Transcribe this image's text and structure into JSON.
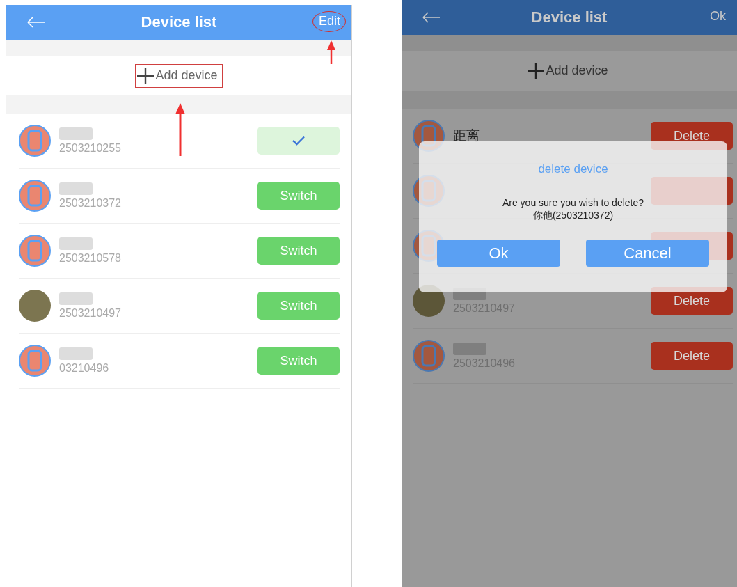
{
  "screens": [
    {
      "dimmed": false,
      "annotated": true,
      "header": {
        "title": "Device list",
        "action": "Edit"
      },
      "add_label": "Add device",
      "rows": [
        {
          "name_blurred": true,
          "avatar": {
            "kind": "watch"
          },
          "id": "2503210255",
          "selected": true,
          "button": {
            "kind": "check"
          }
        },
        {
          "name_blurred": true,
          "avatar": {
            "kind": "watch"
          },
          "id": "2503210372",
          "selected": false,
          "button": {
            "kind": "switch",
            "label": "Switch"
          }
        },
        {
          "name_blurred": true,
          "avatar": {
            "kind": "watch"
          },
          "id": "2503210578",
          "selected": false,
          "button": {
            "kind": "switch",
            "label": "Switch"
          }
        },
        {
          "name_blurred": true,
          "avatar": {
            "kind": "photo"
          },
          "id": "2503210497",
          "selected": false,
          "button": {
            "kind": "switch",
            "label": "Switch"
          }
        },
        {
          "name_blurred": true,
          "avatar": {
            "kind": "watch"
          },
          "id": "03210496",
          "selected": false,
          "button": {
            "kind": "switch",
            "label": "Switch"
          }
        }
      ]
    },
    {
      "dimmed": true,
      "annotated": false,
      "header": {
        "title": "Device list",
        "action": "Ok"
      },
      "add_label": "Add device",
      "rows": [
        {
          "name": "距离",
          "avatar": {
            "kind": "watch"
          },
          "button": {
            "kind": "delete",
            "label": "Delete"
          }
        },
        {
          "avatar": {
            "kind": "watch"
          },
          "button": {
            "kind": "delete"
          }
        },
        {
          "avatar": {
            "kind": "watch"
          },
          "button": {
            "kind": "delete"
          }
        },
        {
          "name_blurred": true,
          "avatar": {
            "kind": "photo"
          },
          "id": "2503210497",
          "button": {
            "kind": "delete",
            "label": "Delete"
          }
        },
        {
          "name_blurred": true,
          "avatar": {
            "kind": "watch"
          },
          "id": "2503210496",
          "button": {
            "kind": "delete",
            "label": "Delete"
          }
        }
      ],
      "dialog": {
        "title": "delete device",
        "message": "Are you sure you wish to delete?",
        "detail": "你他(2503210372)",
        "buttons": [
          "Ok",
          "Cancel"
        ]
      }
    }
  ]
}
